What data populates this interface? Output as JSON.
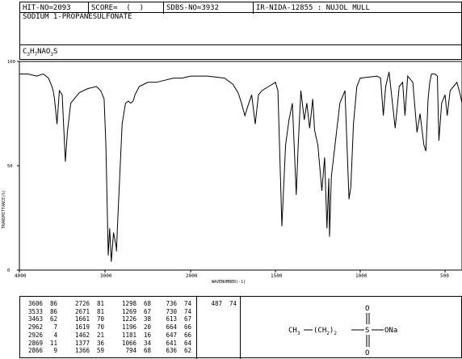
{
  "header": {
    "hit_no": "HIT-NO=2093",
    "score": "SCORE=  (  )",
    "sdbs_no": "SDBS-NO=3932",
    "ir_info": "IR-NIDA-12855 : NUJOL MULL"
  },
  "compound": {
    "name": "SODIUM 1-PROPANESULFONATE",
    "formula": "C3H7NAO3S"
  },
  "chart_data": {
    "type": "line",
    "xlabel": "WAVENUMBER(-1)",
    "ylabel": "TRANSMITTANCE(%)",
    "xlim": [
      4000,
      400
    ],
    "ylim": [
      0,
      100
    ],
    "x_ticks": [
      "4000",
      "3000",
      "2000",
      "1500",
      "1000",
      "500"
    ],
    "y_ticks": [
      "100",
      "50",
      "0"
    ],
    "series": [
      {
        "x": [
          4000,
          3900,
          3800,
          3720,
          3660,
          3620,
          3606,
          3590,
          3560,
          3533,
          3500,
          3463,
          3440,
          3400,
          3300,
          3200,
          3100,
          3050,
          3010,
          2990,
          2962,
          2945,
          2926,
          2900,
          2869,
          2866,
          2850,
          2800,
          2760,
          2726,
          2700,
          2671,
          2650,
          2600,
          2500,
          2400,
          2300,
          2200,
          2100,
          2000,
          1900,
          1800,
          1750,
          1720,
          1700,
          1680,
          1661,
          1640,
          1619,
          1600,
          1580,
          1540,
          1500,
          1485,
          1462,
          1440,
          1420,
          1400,
          1377,
          1366,
          1350,
          1330,
          1315,
          1298,
          1280,
          1269,
          1250,
          1226,
          1210,
          1196,
          1185,
          1181,
          1170,
          1120,
          1090,
          1066,
          1055,
          1040,
          1020,
          1000,
          900,
          880,
          864,
          850,
          830,
          794,
          770,
          750,
          736,
          720,
          690,
          665,
          647,
          640,
          625,
          613,
          600,
          590,
          580,
          560,
          545,
          536,
          520,
          500,
          487,
          470,
          450,
          430,
          410,
          400
        ],
        "y": [
          94,
          94,
          93,
          94,
          92,
          88,
          86,
          82,
          70,
          86,
          84,
          52,
          66,
          80,
          85,
          87,
          88,
          86,
          82,
          60,
          7,
          20,
          4,
          18,
          11,
          9,
          25,
          70,
          80,
          81,
          80,
          81,
          84,
          88,
          90,
          90,
          91,
          92,
          92,
          93,
          93,
          92,
          89,
          85,
          80,
          74,
          79,
          84,
          70,
          84,
          86,
          88,
          90,
          86,
          21,
          60,
          72,
          80,
          36,
          59,
          86,
          72,
          80,
          68,
          82,
          67,
          60,
          38,
          54,
          20,
          44,
          16,
          45,
          80,
          86,
          34,
          40,
          70,
          88,
          92,
          93,
          92,
          74,
          88,
          95,
          68,
          88,
          90,
          74,
          93,
          90,
          66,
          75,
          70,
          60,
          57,
          82,
          90,
          94,
          94,
          93,
          62,
          80,
          84,
          74,
          86,
          88,
          90,
          84,
          80
        ]
      }
    ]
  },
  "peak_table": [
    [
      [
        "3606",
        "86"
      ],
      [
        "3533",
        "86"
      ],
      [
        "3463",
        "62"
      ],
      [
        "2962",
        "7"
      ],
      [
        "2926",
        "4"
      ],
      [
        "2869",
        "11"
      ],
      [
        "2866",
        "9"
      ]
    ],
    [
      [
        "2726",
        "81"
      ],
      [
        "2671",
        "81"
      ],
      [
        "1661",
        "70"
      ],
      [
        "1619",
        "70"
      ],
      [
        "1462",
        "21"
      ],
      [
        "1377",
        "36"
      ],
      [
        "1366",
        "59"
      ]
    ],
    [
      [
        "1298",
        "68"
      ],
      [
        "1269",
        "67"
      ],
      [
        "1226",
        "38"
      ],
      [
        "1196",
        "20"
      ],
      [
        "1181",
        "16"
      ],
      [
        "1066",
        "34"
      ],
      [
        "794",
        "68"
      ]
    ],
    [
      [
        "736",
        "74"
      ],
      [
        "730",
        "74"
      ],
      [
        "613",
        "67"
      ],
      [
        "664",
        "66"
      ],
      [
        "647",
        "66"
      ],
      [
        "641",
        "64"
      ],
      [
        "636",
        "62"
      ]
    ],
    [
      [
        "487",
        "74"
      ]
    ]
  ],
  "structure": {
    "chain_left": "CH3",
    "chain_mid": "(CH2)2",
    "sulfur": "S",
    "oxygen_top": "O",
    "oxygen_bottom": "O",
    "salt": "ONa"
  }
}
